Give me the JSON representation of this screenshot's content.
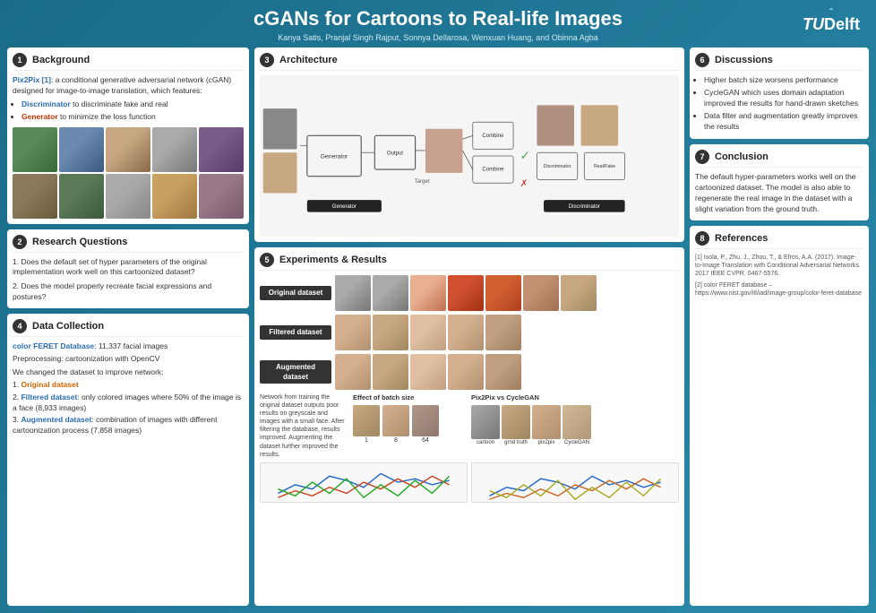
{
  "poster": {
    "title": "cGANs for Cartoons to Real-life Images",
    "authors": "Kanya Satis, Pranjal Singh Rajput, Sonnya Dellarosa, Wenxuan Huang, and Obinna Agba"
  },
  "background": {
    "number": "1",
    "title": "Background",
    "intro": "Pix2Pix [1]: a conditional generative adversarial network (cGAN) designed for image-to-image translation, which features:",
    "bullets": [
      "Discriminator to discriminate fake and real",
      "Generator to minimize the loss function"
    ]
  },
  "research_questions": {
    "number": "2",
    "title": "Research Questions",
    "questions": [
      "Does the default set of hyper parameters of the original implementation work well on this cartoonized dataset?",
      "Does the model properly recreate facial expressions and postures?"
    ]
  },
  "architecture": {
    "number": "3",
    "title": "Architecture",
    "labels": {
      "generator": "Generator",
      "discriminator": "Discriminator"
    }
  },
  "data_collection": {
    "number": "4",
    "title": "Data Collection",
    "database": "color FERET Database",
    "database_desc": ": 11,337 facial images",
    "preprocessing": "Preprocessing: cartoonization with OpenCV",
    "change_text": "We changed the dataset to improve network:",
    "datasets": [
      {
        "name": "Original dataset",
        "desc": ""
      },
      {
        "name": "Filtered dataset",
        "desc": ": only colored images where 50% of the image is a face (8,933 images)"
      },
      {
        "name": "Augmented dataset",
        "desc": ": combination of images with different cartoonization process (7,858 images)"
      }
    ]
  },
  "experiments": {
    "number": "5",
    "title": "Experiments & Results",
    "labels": {
      "original": "Original dataset",
      "filtered": "Filtered dataset",
      "augmented": "Augmented dataset",
      "batch_size": "Effect of batch size",
      "pix2pix_vs": "Pix2Pix vs CycleGAN"
    },
    "caption": "Network from training the original dataset outputs poor results on greyscale and images with a small face. After filtering the database, results improved. Augmenting the dataset further improved the results.",
    "batch_labels": [
      "1",
      "8",
      "64"
    ],
    "comparison_labels": [
      "cartoon",
      "grnd truth",
      "pix2pix",
      "CycleGAN"
    ]
  },
  "discussions": {
    "number": "6",
    "title": "Discussions",
    "bullets": [
      "Higher batch size worsens performance",
      "CycleGAN which uses domain adaptation improved the results for hand-drawn sketches",
      "Data filter and augmentation greatly improves the results"
    ]
  },
  "conclusion": {
    "number": "7",
    "title": "Conclusion",
    "text": "The default hyper-parameters works well on the cartoonized dataset. The model is also able to regenerate the real image in the dataset with a slight variation from the ground truth."
  },
  "references": {
    "number": "8",
    "title": "References",
    "items": [
      "[1] Isola, P., Zhu, J., Zhou, T., & Efros, A.A. (2017). Image-to-Image Translation with Conditional Adversarial Networks. 2017 IEEE CVPR. 0467-5576.",
      "[2] color FERET database – https://www.nist.gov/itl/iad/image-group/color-feret-database"
    ]
  }
}
